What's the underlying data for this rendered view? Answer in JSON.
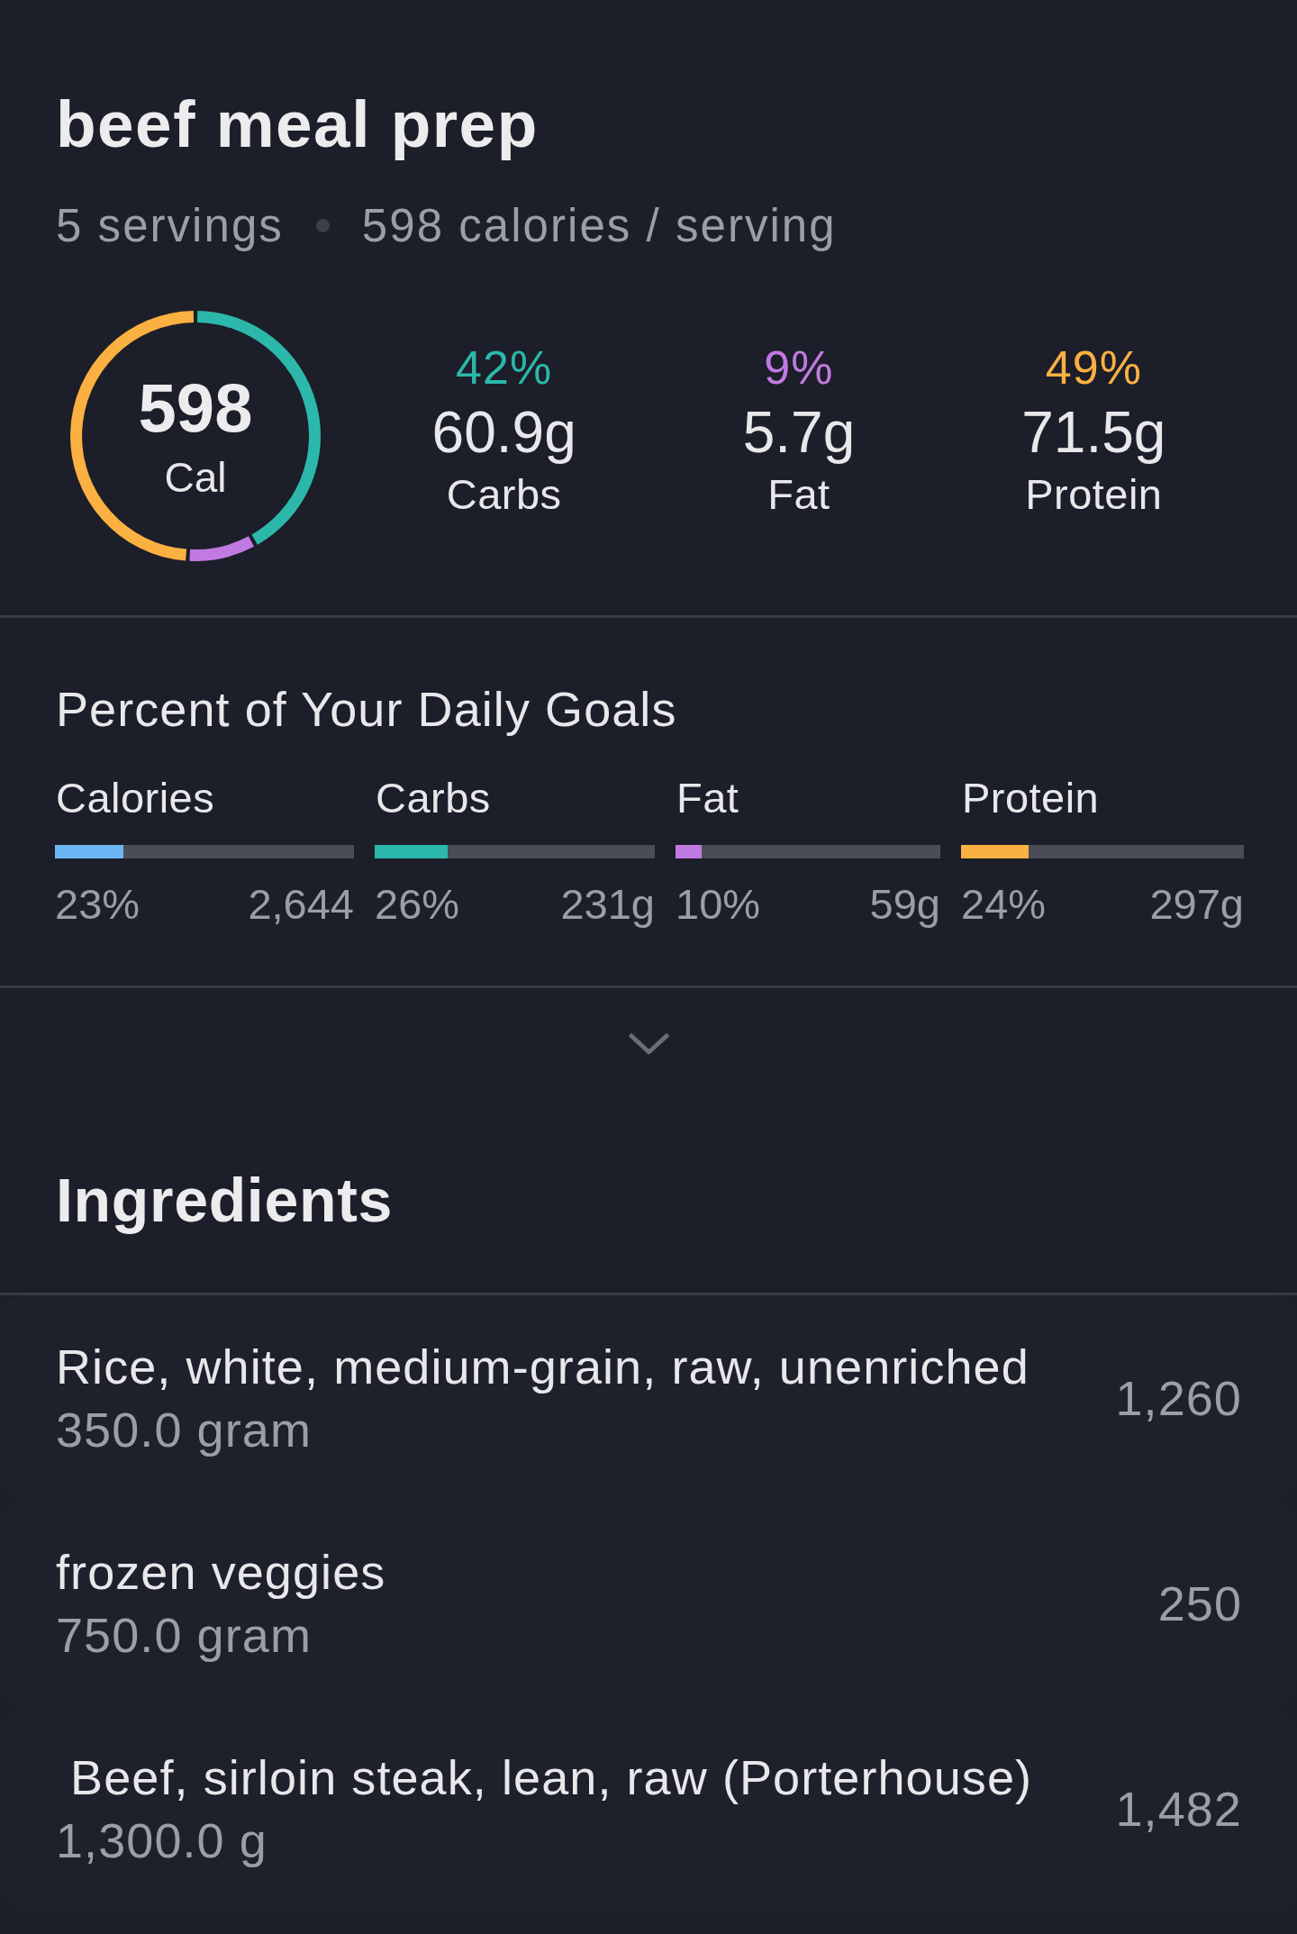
{
  "recipe": {
    "title": "beef meal prep",
    "servings": "5 servings",
    "calories_per_serving": "598 calories / serving"
  },
  "summary": {
    "calories": "598",
    "calories_unit": "Cal",
    "chart_data": {
      "type": "donut",
      "values": [
        42,
        9,
        49
      ]
    },
    "macros": [
      {
        "percent": "42%",
        "grams": "60.9g",
        "label": "Carbs",
        "color": "#2bb8aa"
      },
      {
        "percent": "9%",
        "grams": "5.7g",
        "label": "Fat",
        "color": "#c17ae0"
      },
      {
        "percent": "49%",
        "grams": "71.5g",
        "label": "Protein",
        "color": "#fbb141"
      }
    ]
  },
  "goals": {
    "title": "Percent of Your Daily Goals",
    "items": [
      {
        "label": "Calories",
        "percent": "23%",
        "target": "2,644",
        "color": "#6db6f6",
        "level": 0.23
      },
      {
        "label": "Carbs",
        "percent": "26%",
        "target": "231g",
        "color": "#2bb8aa",
        "level": 0.26
      },
      {
        "label": "Fat",
        "percent": "10%",
        "target": "59g",
        "color": "#c17ae0",
        "level": 0.1
      },
      {
        "label": "Protein",
        "percent": "24%",
        "target": "297g",
        "color": "#fbb141",
        "level": 0.24
      }
    ]
  },
  "expand_toggle": {
    "expanded": false
  },
  "ingredients": {
    "title": "Ingredients",
    "items": [
      {
        "name": "Rice, white, medium-grain, raw, unenriched",
        "amount": "350.0 gram",
        "calories": "1,260"
      },
      {
        "name": "frozen veggies",
        "amount": "750.0 gram",
        "calories": "250"
      },
      {
        "name": " Beef, sirloin steak, lean, raw (Porterhouse)",
        "amount": "1,300.0 g",
        "calories": "1,482"
      }
    ]
  }
}
